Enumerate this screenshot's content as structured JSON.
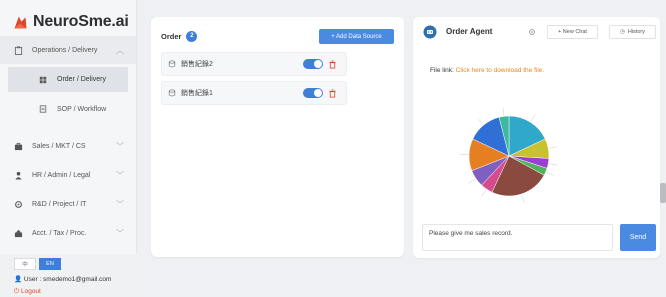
{
  "brand": {
    "name": "NeuroSme.ai"
  },
  "sidebar": {
    "groups": [
      {
        "label": "Operations / Delivery",
        "icon": "clipboard-icon",
        "chevron": "︿"
      },
      {
        "label": "Sales / MKT / CS",
        "icon": "briefcase-icon",
        "chevron": "﹀"
      },
      {
        "label": "HR / Admin / Legal",
        "icon": "person-icon",
        "chevron": "﹀"
      },
      {
        "label": "R&D / Project / IT",
        "icon": "gear-icon",
        "chevron": "﹀"
      },
      {
        "label": "Acct. / Tax / Proc.",
        "icon": "calculator-icon",
        "chevron": "﹀"
      }
    ],
    "sub_items": [
      {
        "label": "Order / Delivery",
        "active": true
      },
      {
        "label": "SOP / Workflow",
        "active": false
      }
    ],
    "lang": {
      "zh": "中",
      "en": "EN"
    },
    "user_label": "User : smedemo1@gmail.com",
    "logout_label": "Logout"
  },
  "order_panel": {
    "title": "Order",
    "count": "2",
    "add_button": "+ Add Data Source",
    "sources": [
      {
        "name": "銷售紀錄2",
        "enabled": true
      },
      {
        "name": "銷售紀錄1",
        "enabled": true
      }
    ]
  },
  "agent_panel": {
    "title": "Order Agent",
    "new_chat": "+ New Chat",
    "history": "History",
    "file_prefix": "File link: ",
    "file_link": "Click here to download the file.",
    "input_value": "Please give me sales record.",
    "send_label": "Send"
  },
  "chart_data": {
    "type": "pie",
    "values": [
      18,
      8,
      4,
      3,
      24,
      5,
      7,
      13,
      14,
      4
    ],
    "colors": [
      "#2fa8c9",
      "#c9c12f",
      "#9a3fd6",
      "#4fb35a",
      "#8a4a3f",
      "#d64a8f",
      "#7f5fbf",
      "#e67e22",
      "#2f6fd6",
      "#3fb8a0"
    ]
  },
  "colors": {
    "accent": "#3d7fd9",
    "danger": "#e0442b",
    "link": "#e68a1a"
  }
}
